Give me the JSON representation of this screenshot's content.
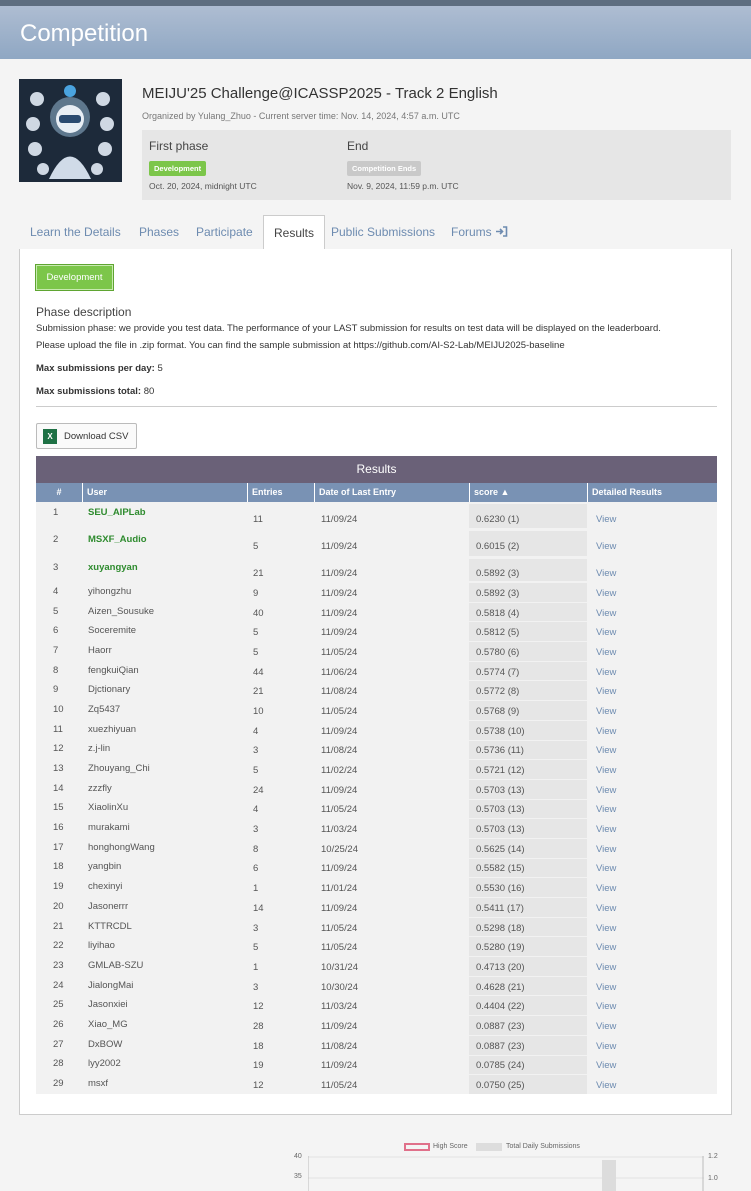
{
  "header": {
    "title": "Competition"
  },
  "competition": {
    "title": "MEIJU'25 Challenge@ICASSP2025 - Track 2 English",
    "organizer_line": "Organized by Yulang_Zhuo - Current server time: Nov. 14, 2024, 4:57 a.m. UTC",
    "phases": [
      {
        "title": "First phase",
        "badge": "Development",
        "date": "Oct. 20, 2024, midnight UTC",
        "badge_color": "#7cc64a"
      },
      {
        "title": "End",
        "badge": "Competition Ends",
        "date": "Nov. 9, 2024, 11:59 p.m. UTC",
        "badge_color": "#c9c9c9"
      }
    ]
  },
  "tabs": [
    {
      "label": "Learn the Details"
    },
    {
      "label": "Phases"
    },
    {
      "label": "Participate"
    },
    {
      "label": "Results"
    },
    {
      "label": "Public Submissions"
    },
    {
      "label": "Forums"
    }
  ],
  "results": {
    "phase_button": "Development",
    "desc_title": "Phase description",
    "desc_line1": "Submission phase: we provide you test data. The performance of your LAST submission for results on test data will be displayed on the leaderboard.",
    "desc_line2": "Please upload the file in .zip format. You can find the sample submission at https://github.com/AI-S2-Lab/MEIJU2025-baseline",
    "max_per_day_label": "Max submissions per day:",
    "max_per_day": "5",
    "max_total_label": "Max submissions total:",
    "max_total": "80",
    "download_label": "Download CSV",
    "table_caption": "Results",
    "columns": [
      "#",
      "User",
      "Entries",
      "Date of Last Entry",
      "score ▲",
      "Detailed Results"
    ],
    "rows": [
      [
        "1",
        "SEU_AIPLab",
        "11",
        "11/09/24",
        "0.6230 (1)",
        "View"
      ],
      [
        "2",
        "MSXF_Audio",
        "5",
        "11/09/24",
        "0.6015 (2)",
        "View"
      ],
      [
        "3",
        "xuyangyan",
        "21",
        "11/09/24",
        "0.5892 (3)",
        "View"
      ],
      [
        "4",
        "yihongzhu",
        "9",
        "11/09/24",
        "0.5892 (3)",
        "View"
      ],
      [
        "5",
        "Aizen_Sousuke",
        "40",
        "11/09/24",
        "0.5818 (4)",
        "View"
      ],
      [
        "6",
        "Soceremite",
        "5",
        "11/09/24",
        "0.5812 (5)",
        "View"
      ],
      [
        "7",
        "Haorr",
        "5",
        "11/05/24",
        "0.5780 (6)",
        "View"
      ],
      [
        "8",
        "fengkuiQian",
        "44",
        "11/06/24",
        "0.5774 (7)",
        "View"
      ],
      [
        "9",
        "Djctionary",
        "21",
        "11/08/24",
        "0.5772 (8)",
        "View"
      ],
      [
        "10",
        "Zq5437",
        "10",
        "11/05/24",
        "0.5768 (9)",
        "View"
      ],
      [
        "11",
        "xuezhiyuan",
        "4",
        "11/09/24",
        "0.5738 (10)",
        "View"
      ],
      [
        "12",
        "z.j-lin",
        "3",
        "11/08/24",
        "0.5736 (11)",
        "View"
      ],
      [
        "13",
        "Zhouyang_Chi",
        "5",
        "11/02/24",
        "0.5721 (12)",
        "View"
      ],
      [
        "14",
        "zzzfly",
        "24",
        "11/09/24",
        "0.5703 (13)",
        "View"
      ],
      [
        "15",
        "XiaolinXu",
        "4",
        "11/05/24",
        "0.5703 (13)",
        "View"
      ],
      [
        "16",
        "murakami",
        "3",
        "11/03/24",
        "0.5703 (13)",
        "View"
      ],
      [
        "17",
        "honghongWang",
        "8",
        "10/25/24",
        "0.5625 (14)",
        "View"
      ],
      [
        "18",
        "yangbin",
        "6",
        "11/09/24",
        "0.5582 (15)",
        "View"
      ],
      [
        "19",
        "chexinyi",
        "1",
        "11/01/24",
        "0.5530 (16)",
        "View"
      ],
      [
        "20",
        "Jasonerrr",
        "14",
        "11/09/24",
        "0.5411 (17)",
        "View"
      ],
      [
        "21",
        "KTTRCDL",
        "3",
        "11/05/24",
        "0.5298 (18)",
        "View"
      ],
      [
        "22",
        "liyihao",
        "5",
        "11/05/24",
        "0.5280 (19)",
        "View"
      ],
      [
        "23",
        "GMLAB-SZU",
        "1",
        "10/31/24",
        "0.4713 (20)",
        "View"
      ],
      [
        "24",
        "JialongMai",
        "3",
        "10/30/24",
        "0.4628 (21)",
        "View"
      ],
      [
        "25",
        "Jasonxiei",
        "12",
        "11/03/24",
        "0.4404 (22)",
        "View"
      ],
      [
        "26",
        "Xiao_MG",
        "28",
        "11/09/24",
        "0.0887 (23)",
        "View"
      ],
      [
        "27",
        "DxBOW",
        "18",
        "11/08/24",
        "0.0887 (23)",
        "View"
      ],
      [
        "28",
        "lyy2002",
        "19",
        "11/09/24",
        "0.0785 (24)",
        "View"
      ],
      [
        "29",
        "msxf",
        "12",
        "11/05/24",
        "0.0750 (25)",
        "View"
      ]
    ]
  },
  "chart": {
    "legend_high": "High Score",
    "legend_daily": "Total Daily Submissions",
    "left_ticks": [
      "40",
      "35"
    ],
    "right_ticks": [
      "1.2",
      "1.0"
    ]
  }
}
